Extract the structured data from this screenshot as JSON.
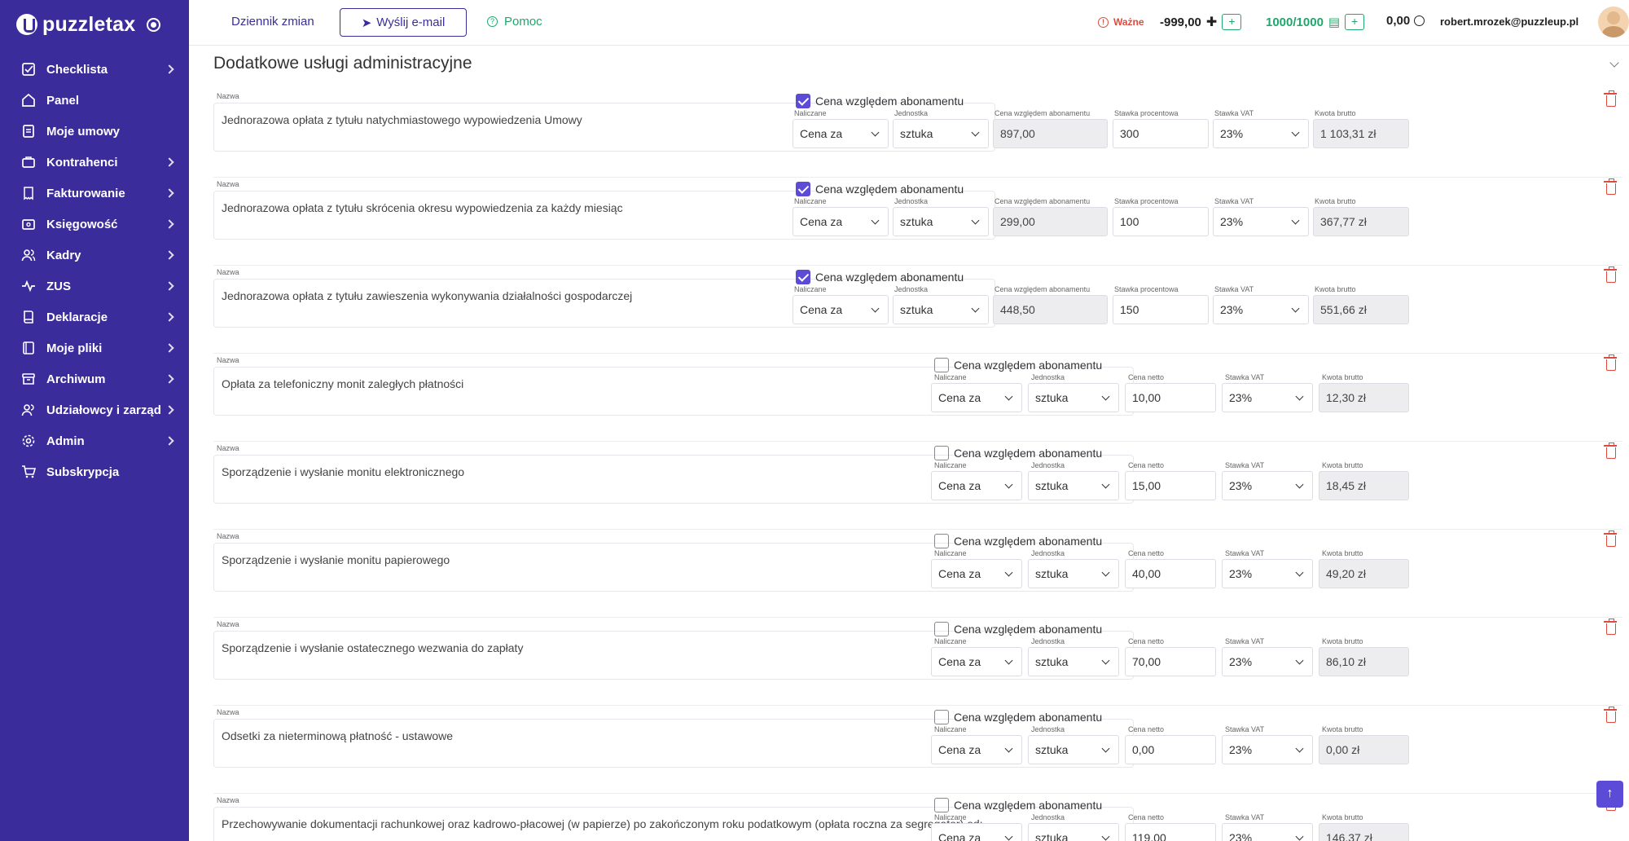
{
  "app": {
    "logo_text": "puzzletax"
  },
  "sidebar": {
    "items": [
      {
        "label": "Checklista",
        "icon": "checklist-icon",
        "chevron": true
      },
      {
        "label": "Panel",
        "icon": "home-icon",
        "chevron": false
      },
      {
        "label": "Moje umowy",
        "icon": "contract-icon",
        "chevron": false
      },
      {
        "label": "Kontrahenci",
        "icon": "contractors-icon",
        "chevron": true
      },
      {
        "label": "Fakturowanie",
        "icon": "invoice-icon",
        "chevron": true
      },
      {
        "label": "Księgowość",
        "icon": "accounting-icon",
        "chevron": true
      },
      {
        "label": "Kadry",
        "icon": "people-icon",
        "chevron": true
      },
      {
        "label": "ZUS",
        "icon": "pulse-icon",
        "chevron": true
      },
      {
        "label": "Deklaracje",
        "icon": "declaration-icon",
        "chevron": true
      },
      {
        "label": "Moje pliki",
        "icon": "folder-icon",
        "chevron": true
      },
      {
        "label": "Archiwum",
        "icon": "archive-icon",
        "chevron": true
      },
      {
        "label": "Udziałowcy i zarząd",
        "icon": "shareholders-icon",
        "chevron": true
      },
      {
        "label": "Admin",
        "icon": "gear-icon",
        "chevron": true
      },
      {
        "label": "Subskrypcja",
        "icon": "cart-icon",
        "chevron": false
      }
    ]
  },
  "topbar": {
    "changelog": "Dziennik zmian",
    "send_email": "Wyślij e-mail",
    "help": "Pomoc",
    "important": "Ważne",
    "credits": "-999,00",
    "docs": "1000/1000",
    "balance": "0,00",
    "user_email": "robert.mrozek@puzzleup.pl"
  },
  "section": {
    "title": "Dodatkowe usługi administracyjne"
  },
  "labels": {
    "name": "Nazwa",
    "subscription_price_checkbox": "Cena względem abonamentu",
    "charged": "Naliczane",
    "unit": "Jednostka",
    "subscription_price": "Cena względem abonamentu",
    "percent_rate": "Stawka procentowa",
    "net_price": "Cena netto",
    "vat_rate": "Stawka VAT",
    "gross_amount": "Kwota brutto"
  },
  "rows": [
    {
      "name": "Jednorazowa opłata z tytułu natychmiastowego wypowiedzenia Umowy",
      "checked": true,
      "charged": "Cena za",
      "unit": "sztuka",
      "subscription_price": "897,00",
      "percent": "300",
      "vat": "23%",
      "gross": "1 103,31 zł"
    },
    {
      "name": "Jednorazowa opłata z tytułu skrócenia okresu wypowiedzenia za każdy miesiąc",
      "checked": true,
      "charged": "Cena za",
      "unit": "sztuka",
      "subscription_price": "299,00",
      "percent": "100",
      "vat": "23%",
      "gross": "367,77 zł"
    },
    {
      "name": "Jednorazowa opłata z tytułu zawieszenia wykonywania działalności gospodarczej",
      "checked": true,
      "charged": "Cena za",
      "unit": "sztuka",
      "subscription_price": "448,50",
      "percent": "150",
      "vat": "23%",
      "gross": "551,66 zł"
    },
    {
      "name": "Opłata za telefoniczny monit zaległych płatności",
      "checked": false,
      "charged": "Cena za",
      "unit": "sztuka",
      "net": "10,00",
      "vat": "23%",
      "gross": "12,30 zł"
    },
    {
      "name": "Sporządzenie i wysłanie monitu elektronicznego",
      "checked": false,
      "charged": "Cena za",
      "unit": "sztuka",
      "net": "15,00",
      "vat": "23%",
      "gross": "18,45 zł"
    },
    {
      "name": "Sporządzenie i wysłanie monitu papierowego",
      "checked": false,
      "charged": "Cena za",
      "unit": "sztuka",
      "net": "40,00",
      "vat": "23%",
      "gross": "49,20 zł"
    },
    {
      "name": "Sporządzenie i wysłanie ostatecznego wezwania do zapłaty",
      "checked": false,
      "charged": "Cena za",
      "unit": "sztuka",
      "net": "70,00",
      "vat": "23%",
      "gross": "86,10 zł"
    },
    {
      "name": "Odsetki za nieterminową płatność - ustawowe",
      "checked": false,
      "charged": "Cena za",
      "unit": "sztuka",
      "net": "0,00",
      "vat": "23%",
      "gross": "0,00 zł"
    },
    {
      "name": "Przechowywanie dokumentacji rachunkowej oraz kadrowo-płacowej (w papierze) po zakończonym roku podatkowym (opłata roczna za segregator) od:",
      "checked": false,
      "charged": "Cena za",
      "unit": "sztuka",
      "net": "119,00",
      "vat": "23%",
      "gross": "146,37 zł"
    }
  ],
  "colors": {
    "sidebar": "#3a2d9b",
    "accent": "#5b4bd6",
    "green": "#20a76b",
    "danger": "#e0493c"
  }
}
